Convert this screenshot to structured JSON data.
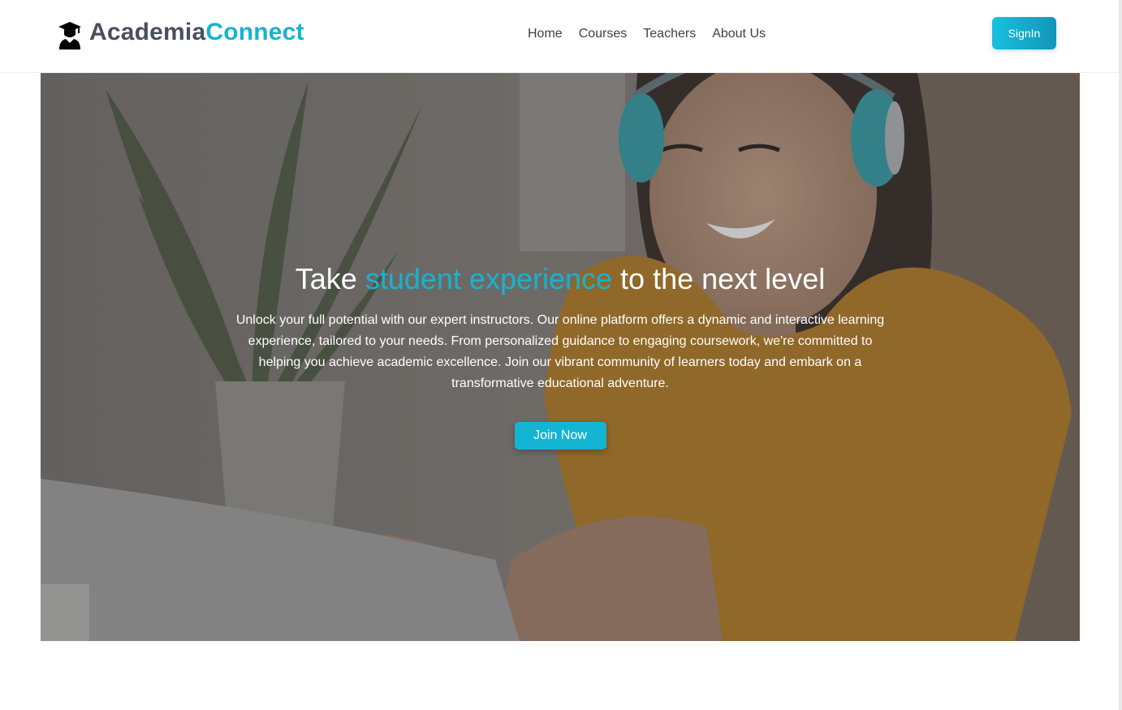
{
  "brand": {
    "name_part1": "Academia",
    "name_part2": "Connect",
    "icon": "graduate-cap-icon"
  },
  "nav": {
    "items": [
      {
        "label": "Home"
      },
      {
        "label": "Courses"
      },
      {
        "label": "Teachers"
      },
      {
        "label": "About Us"
      }
    ],
    "signin_label": "SignIn"
  },
  "hero": {
    "title_prefix": "Take ",
    "title_accent": "student experience",
    "title_suffix": " to the next level",
    "description": "Unlock your full potential with our expert instructors. Our online platform offers a dynamic and interactive learning experience, tailored to your needs. From personalized guidance to engaging coursework, we're committed to helping you achieve academic excellence. Join our vibrant community of learners today and embark on a transformative educational adventure.",
    "cta_label": "Join Now",
    "background": "student-with-headphones-photo"
  },
  "colors": {
    "accent": "#17b3cf",
    "brand_dark": "#4a4f5c",
    "text_white": "#ffffff"
  }
}
